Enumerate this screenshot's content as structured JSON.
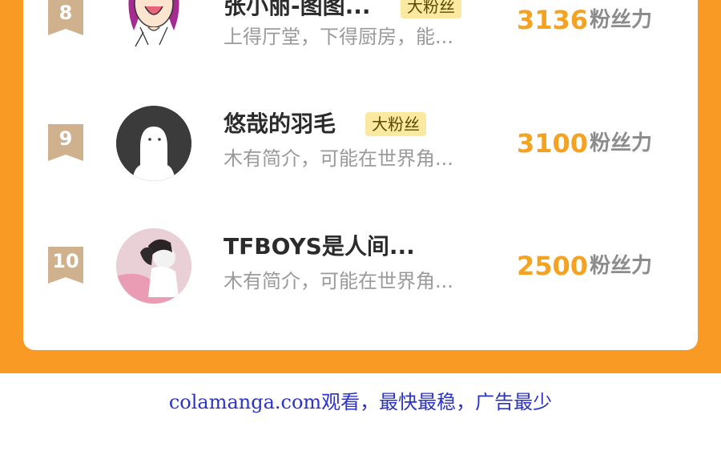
{
  "ranking": {
    "score_unit": "粉丝力",
    "items": [
      {
        "rank": "8",
        "name": "张小丽-图图...",
        "badge": "大粉丝",
        "desc": "上得厅堂，下得厨房，能...",
        "score": "3136",
        "avatar": "cartoon-woman-avatar"
      },
      {
        "rank": "9",
        "name": "悠哉的羽毛",
        "badge": "大粉丝",
        "desc": "木有简介，可能在世界角...",
        "score": "3100",
        "avatar": "default-ghost-avatar"
      },
      {
        "rank": "10",
        "name": "TFBOYS是人间...",
        "badge": "",
        "desc": "木有简介，可能在世界角...",
        "score": "2500",
        "avatar": "photo-girl-avatar"
      }
    ]
  },
  "footer": {
    "text": "colamanga.com观看，最快最稳，广告最少"
  },
  "colors": {
    "background": "#f99a24",
    "score": "#f4a221",
    "badge_bg": "#fbe9a1",
    "rank_badge": "#cfb18e",
    "footer_text": "#2b33c8"
  }
}
